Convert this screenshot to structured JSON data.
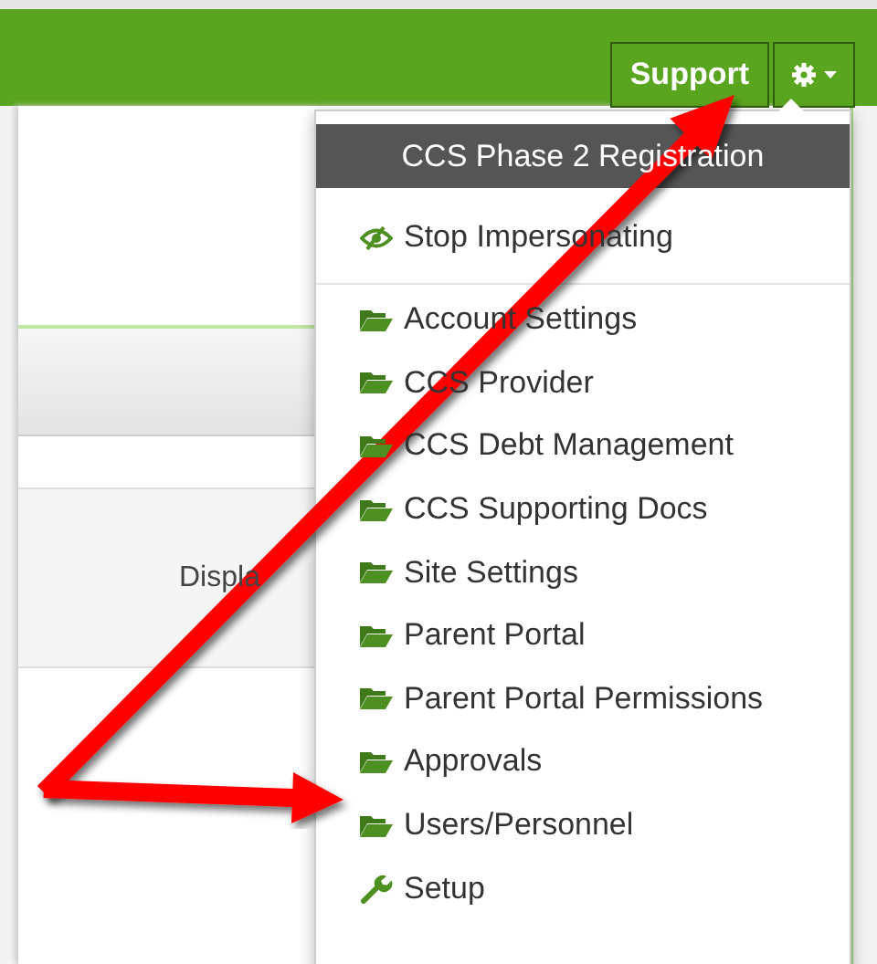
{
  "top_bar": {
    "support_button": "Support"
  },
  "background_page": {
    "row_label": "Displa"
  },
  "dropdown_menu": {
    "header": "CCS Phase 2 Registration",
    "sections": [
      [
        {
          "kind": "impersonation",
          "label": "Stop Impersonating"
        }
      ],
      [
        {
          "kind": "folder",
          "label": "Account Settings"
        },
        {
          "kind": "folder",
          "label": "CCS Provider"
        },
        {
          "kind": "folder",
          "label": "CCS Debt Management"
        },
        {
          "kind": "folder",
          "label": "CCS Supporting Docs"
        },
        {
          "kind": "folder",
          "label": "Site Settings"
        },
        {
          "kind": "folder",
          "label": "Parent Portal"
        },
        {
          "kind": "folder",
          "label": "Parent Portal Permissions"
        },
        {
          "kind": "folder",
          "label": "Approvals"
        },
        {
          "kind": "folder",
          "label": "Users/Personnel"
        },
        {
          "kind": "tool",
          "label": "Setup"
        }
      ]
    ]
  }
}
